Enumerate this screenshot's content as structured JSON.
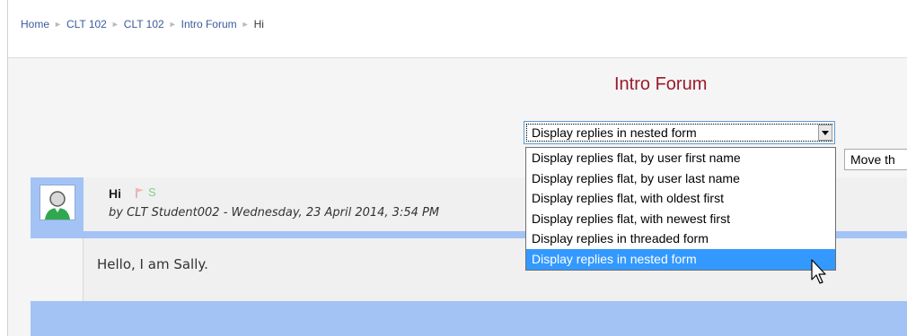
{
  "breadcrumb": [
    {
      "label": "Home"
    },
    {
      "label": "CLT 102"
    },
    {
      "label": "CLT 102"
    },
    {
      "label": "Intro Forum"
    },
    {
      "label": "Hi"
    }
  ],
  "forum": {
    "title": "Intro Forum"
  },
  "display_mode": {
    "selected": "Display replies in nested form",
    "options": [
      "Display replies flat, by user first name",
      "Display replies flat, by user last name",
      "Display replies flat, with oldest first",
      "Display replies flat, with newest first",
      "Display replies in threaded form",
      "Display replies in nested form"
    ]
  },
  "move_control": {
    "label": "Move th"
  },
  "post": {
    "subject": "Hi",
    "byline": "by CLT Student002 - Wednesday, 23 April 2014, 3:54 PM",
    "s_icon_text": "S",
    "message": "Hello, I am Sally."
  },
  "colors": {
    "post_header_bg": "#a4c3f5",
    "selected_option_bg": "#3399ff",
    "forum_title": "#9b1b2b"
  }
}
